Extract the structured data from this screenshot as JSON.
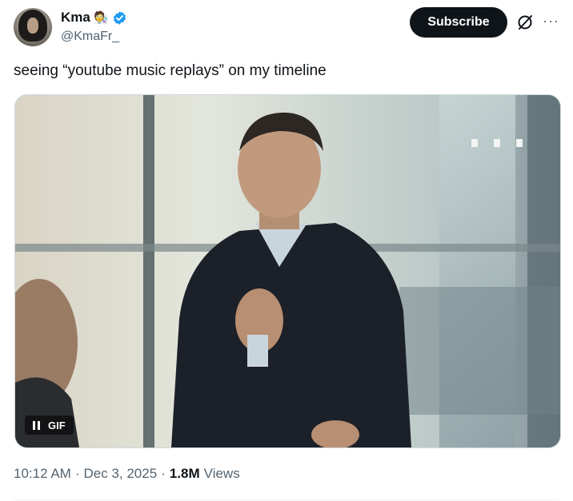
{
  "author": {
    "display_name": "Kma",
    "emoji": "🧑‍🔬",
    "handle": "@KmaFr_",
    "verified": true
  },
  "actions": {
    "subscribe_label": "Subscribe",
    "more_label": "···"
  },
  "tweet": {
    "text": "seeing “youtube music replays” on my timeline"
  },
  "media": {
    "badge_label": "GIF",
    "state": "playing"
  },
  "meta": {
    "time": "10:12 AM",
    "separator": "·",
    "date": "Dec 3, 2025",
    "views_count": "1.8M",
    "views_label": "Views"
  },
  "colors": {
    "verified": "#1d9bf0",
    "text_primary": "#0f1419",
    "text_secondary": "#536471",
    "button_bg": "#0f1419"
  }
}
